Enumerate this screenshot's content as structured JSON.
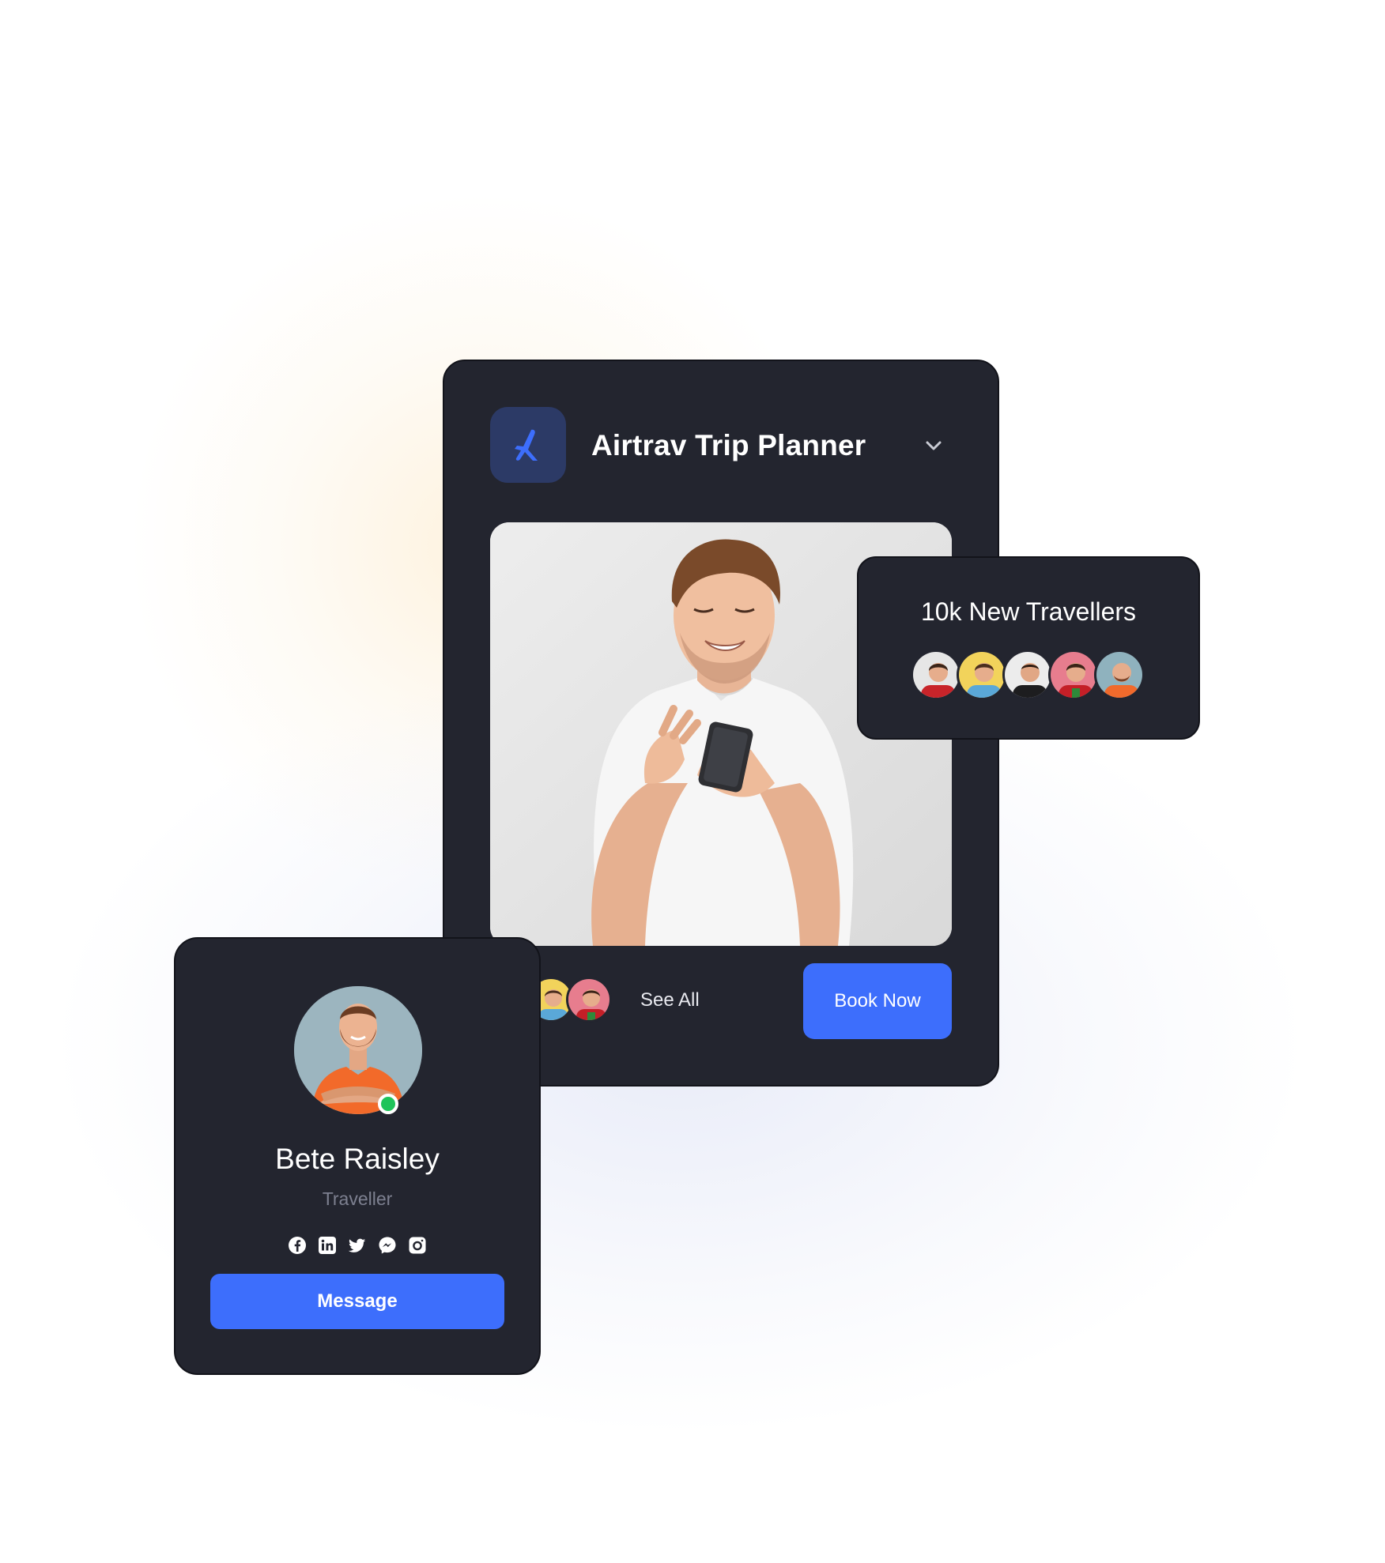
{
  "colors": {
    "card_bg": "#23252f",
    "accent": "#3d6efc",
    "logo_bg": "#2c3a66",
    "online": "#1ec45a",
    "muted_text": "#7d8090"
  },
  "main_card": {
    "logo_icon": "airtrav-logo-icon",
    "title": "Airtrav Trip Planner",
    "dropdown_icon": "chevron-down-icon",
    "see_all_label": "See All",
    "book_now_label": "Book Now"
  },
  "travellers_card": {
    "title": "10k New Travellers"
  },
  "profile_card": {
    "name": "Bete Raisley",
    "role": "Traveller",
    "status": "online",
    "social_icons": [
      "facebook-icon",
      "linkedin-icon",
      "twitter-icon",
      "messenger-icon",
      "instagram-icon"
    ],
    "message_label": "Message"
  }
}
